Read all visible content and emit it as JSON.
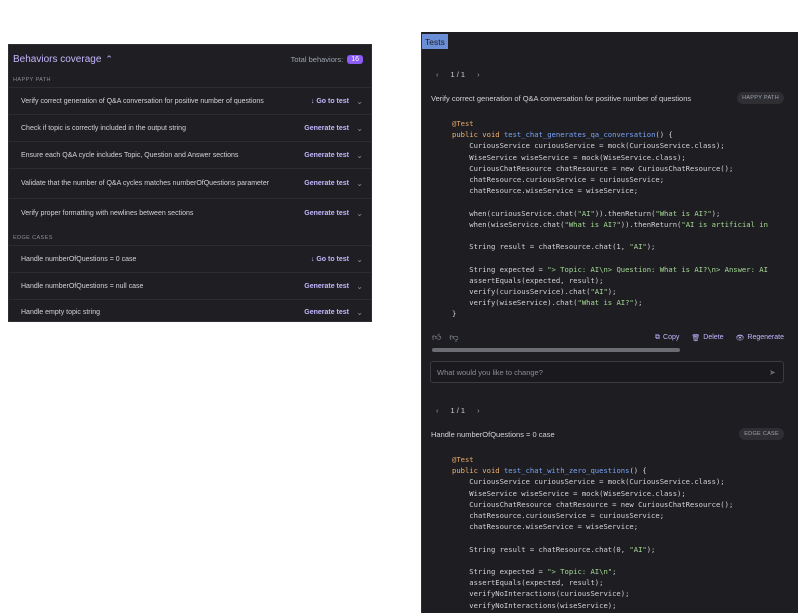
{
  "behaviors": {
    "title": "Behaviors coverage",
    "total_label": "Total behaviors:",
    "total_count": "16",
    "sections": [
      {
        "label": "HAPPY PATH",
        "items": [
          {
            "text": "Verify correct generation of Q&A conversation for positive number of questions",
            "action": "↓ Go to test"
          },
          {
            "text": "Check if topic is correctly included in the output string",
            "action": "Generate test"
          },
          {
            "text": "Ensure each Q&A cycle includes Topic, Question and Answer sections",
            "action": "Generate test"
          },
          {
            "text": "Validate that the number of Q&A cycles matches numberOfQuestions parameter",
            "action": "Generate test"
          },
          {
            "text": "Verify proper formatting with newlines between sections",
            "action": "Generate test"
          }
        ]
      },
      {
        "label": "EDGE CASES",
        "items": [
          {
            "text": "Handle numberOfQuestions = 0 case",
            "action": "↓ Go to test"
          },
          {
            "text": "Handle numberOfQuestions = null case",
            "action": "Generate test"
          },
          {
            "text": "Handle empty topic string",
            "action": "Generate test"
          }
        ]
      }
    ]
  },
  "tests": {
    "title": "Tests",
    "cards": [
      {
        "pager": "1 / 1",
        "description": "Verify correct generation of Q&A conversation for positive number of questions",
        "tag": "HAPPY PATH",
        "code": [
          "@Test",
          "public void test_chat_generates_qa_conversation() {",
          "    CuriousService curiousService = mock(CuriousService.class);",
          "    WiseService wiseService = mock(WiseService.class);",
          "    CuriousChatResource chatResource = new CuriousChatResource();",
          "    chatResource.curiousService = curiousService;",
          "    chatResource.wiseService = wiseService;",
          "",
          "    when(curiousService.chat(\"AI\")).thenReturn(\"What is AI?\");",
          "    when(wiseService.chat(\"What is AI?\")).thenReturn(\"AI is artificial in",
          "",
          "    String result = chatResource.chat(1, \"AI\");",
          "",
          "    String expected = \"> Topic: AI\\n> Question: What is AI?\\n> Answer: AI",
          "    assertEquals(expected, result);",
          "    verify(curiousService).chat(\"AI\");",
          "    verify(wiseService).chat(\"What is AI?\");",
          "}"
        ],
        "copy": "Copy",
        "delete": "Delete",
        "regenerate": "Regenerate",
        "input_placeholder": "What would you like to change?"
      },
      {
        "pager": "1 / 1",
        "description": "Handle numberOfQuestions = 0 case",
        "tag": "EDGE CASE",
        "code": [
          "@Test",
          "public void test_chat_with_zero_questions() {",
          "    CuriousService curiousService = mock(CuriousService.class);",
          "    WiseService wiseService = mock(WiseService.class);",
          "    CuriousChatResource chatResource = new CuriousChatResource();",
          "    chatResource.curiousService = curiousService;",
          "    chatResource.wiseService = wiseService;",
          "",
          "    String result = chatResource.chat(0, \"AI\");",
          "",
          "    String expected = \"> Topic: AI\\n\";",
          "    assertEquals(expected, result);",
          "    verifyNoInteractions(curiousService);",
          "    verifyNoInteractions(wiseService);"
        ]
      }
    ]
  }
}
